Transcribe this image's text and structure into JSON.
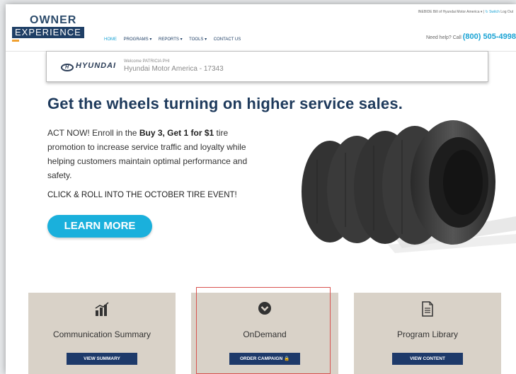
{
  "header": {
    "logo_line1": "OWNER",
    "logo_line2": "EXPERIENCE",
    "account_menu": "INEBIDE Bill of Hyundai Motor America ▾",
    "switch_label": "↻ Switch",
    "logout_label": "Log Out",
    "nav": [
      "HOME",
      "PROGRAMS ▾",
      "REPORTS ▾",
      "TOOLS ▾",
      "CONTACT US"
    ],
    "help_text": "Need help? Call",
    "help_phone": "(800) 505-4998"
  },
  "dealer": {
    "brand": "HYUNDAI",
    "welcome": "Welcome PATRICIA PHI",
    "name": "Hyundai Motor America - 17343"
  },
  "hero": {
    "headline": "Get the wheels turning on higher service sales.",
    "body_pre": "ACT NOW! Enroll in the ",
    "body_bold": "Buy 3, Get 1 for $1",
    "body_post": " tire promotion to increase service traffic and loyalty while helping customers maintain optimal performance and safety.",
    "cta": "CLICK & ROLL INTO THE OCTOBER TIRE EVENT!",
    "button": "LEARN MORE"
  },
  "cards": [
    {
      "title": "Communication Summary",
      "button": "VIEW SUMMARY",
      "icon": "bar-chart-icon"
    },
    {
      "title": "OnDemand",
      "button": "ORDER CAMPAIGN 🔒",
      "icon": "chevron-down-circle-icon"
    },
    {
      "title": "Program Library",
      "button": "VIEW CONTENT",
      "icon": "document-icon"
    }
  ],
  "colors": {
    "navy": "#1e3a5c",
    "accent": "#1ab0dc",
    "card": "#d9d2c8",
    "highlight": "#d9534f"
  }
}
